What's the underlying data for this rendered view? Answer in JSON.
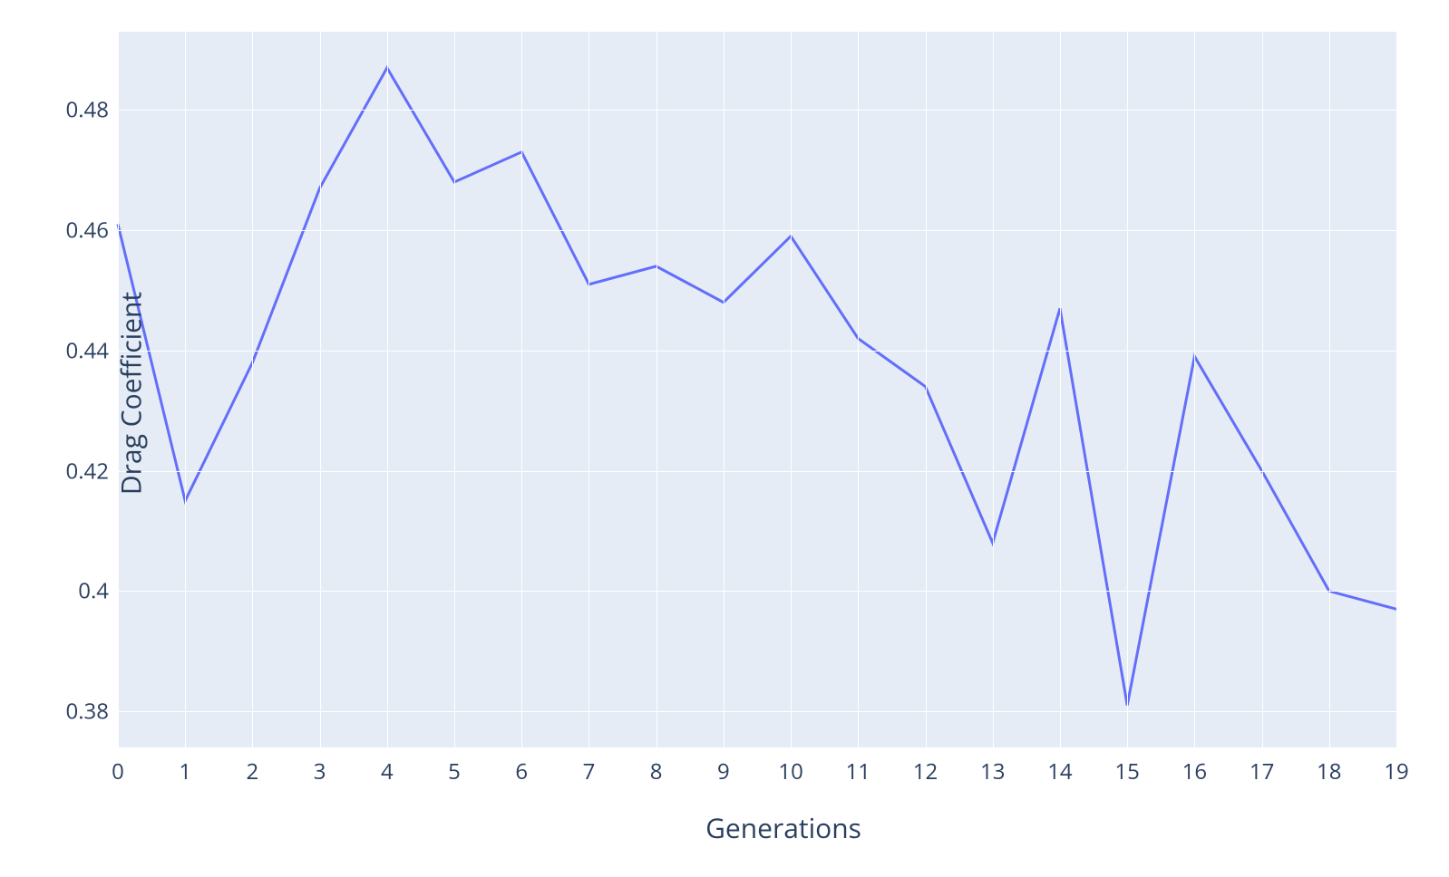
{
  "chart_data": {
    "type": "line",
    "title": "",
    "xlabel": "Generations",
    "ylabel": "Drag Coefficient",
    "x": [
      0,
      1,
      2,
      3,
      4,
      5,
      6,
      7,
      8,
      9,
      10,
      11,
      12,
      13,
      14,
      15,
      16,
      17,
      18,
      19
    ],
    "values": [
      0.461,
      0.415,
      0.438,
      0.467,
      0.487,
      0.468,
      0.473,
      0.451,
      0.454,
      0.448,
      0.459,
      0.442,
      0.434,
      0.408,
      0.447,
      0.381,
      0.439,
      0.42,
      0.4,
      0.397
    ],
    "xlim": [
      0,
      19
    ],
    "ylim": [
      0.374,
      0.493
    ],
    "x_ticks": [
      0,
      1,
      2,
      3,
      4,
      5,
      6,
      7,
      8,
      9,
      10,
      11,
      12,
      13,
      14,
      15,
      16,
      17,
      18,
      19
    ],
    "y_ticks": [
      0.38,
      0.4,
      0.42,
      0.44,
      0.46,
      0.48
    ],
    "y_tick_labels": [
      "0.38",
      "0.4",
      "0.42",
      "0.44",
      "0.46",
      "0.48"
    ],
    "line_color": "#636efa",
    "grid_color": "#ffffff",
    "plot_bg": "#e5ecf6",
    "text_color": "#2a3f5f"
  }
}
